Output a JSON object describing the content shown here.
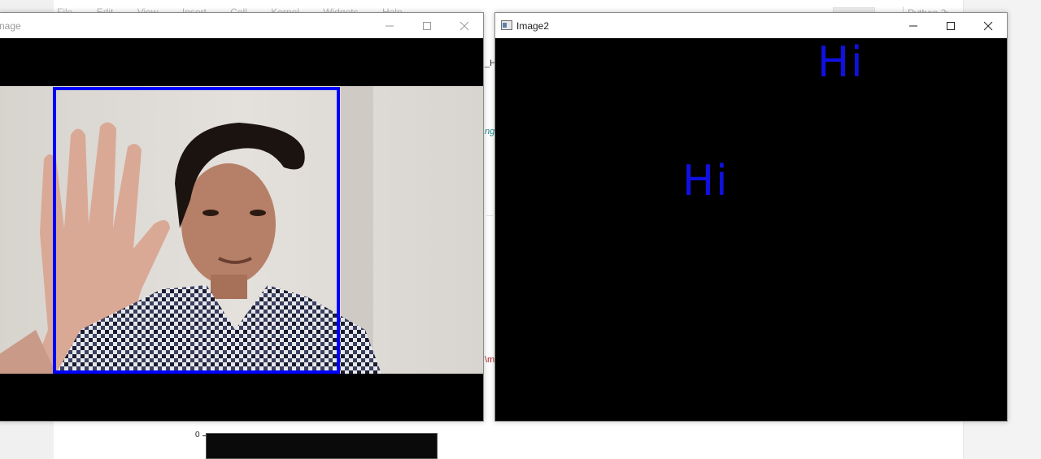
{
  "background": {
    "menu_items": [
      "File",
      "Edit",
      "View",
      "Insert",
      "Cell",
      "Kernel",
      "Widgets",
      "Help"
    ],
    "toolbar_right": "Python 3",
    "gap_snippets": [
      "_H",
      "ng",
      "\\m"
    ],
    "plot_tick": "0"
  },
  "window_left": {
    "title": "nage",
    "controls": {
      "minimize": "minimize",
      "maximize": "maximize",
      "close": "close"
    }
  },
  "window_right": {
    "title": "Image2",
    "texts": [
      "Hi",
      "Hi"
    ],
    "text_color": "#1010e0"
  },
  "colors": {
    "bbox": "#0000ff",
    "canvas": "#000000"
  }
}
